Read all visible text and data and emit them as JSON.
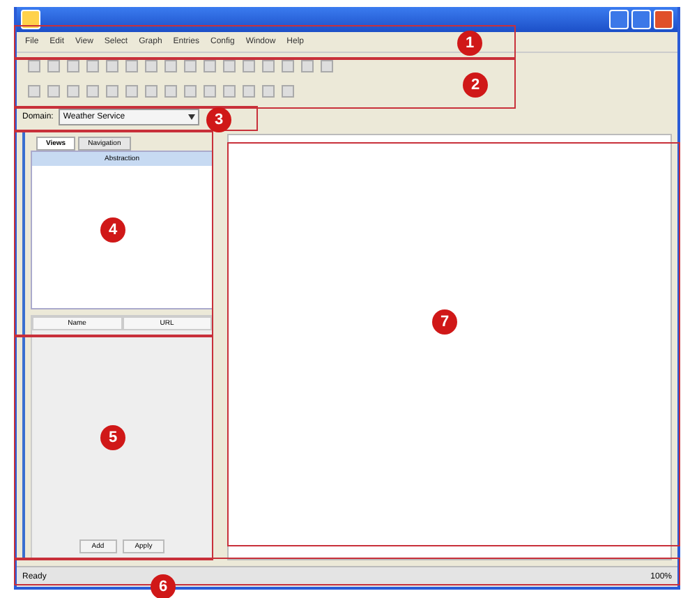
{
  "menu": [
    "File",
    "Edit",
    "View",
    "Select",
    "Graph",
    "Entries",
    "Config",
    "Window",
    "Help"
  ],
  "domain": {
    "label": "Domain:",
    "value": "Weather Service"
  },
  "tabs": [
    {
      "label": "Views",
      "selected": true
    },
    {
      "label": "Navigation",
      "selected": false
    }
  ],
  "view_header": "Abstraction",
  "table": {
    "columns": [
      "Name",
      "URL"
    ]
  },
  "buttons": [
    "Add",
    "Apply"
  ],
  "status_bar": {
    "text": "Ready",
    "zoom": "100%"
  },
  "annotations": [
    {
      "label": "1"
    },
    {
      "label": "2"
    },
    {
      "label": "3"
    },
    {
      "label": "4"
    },
    {
      "label": "5"
    },
    {
      "label": "6"
    },
    {
      "label": "7"
    }
  ]
}
